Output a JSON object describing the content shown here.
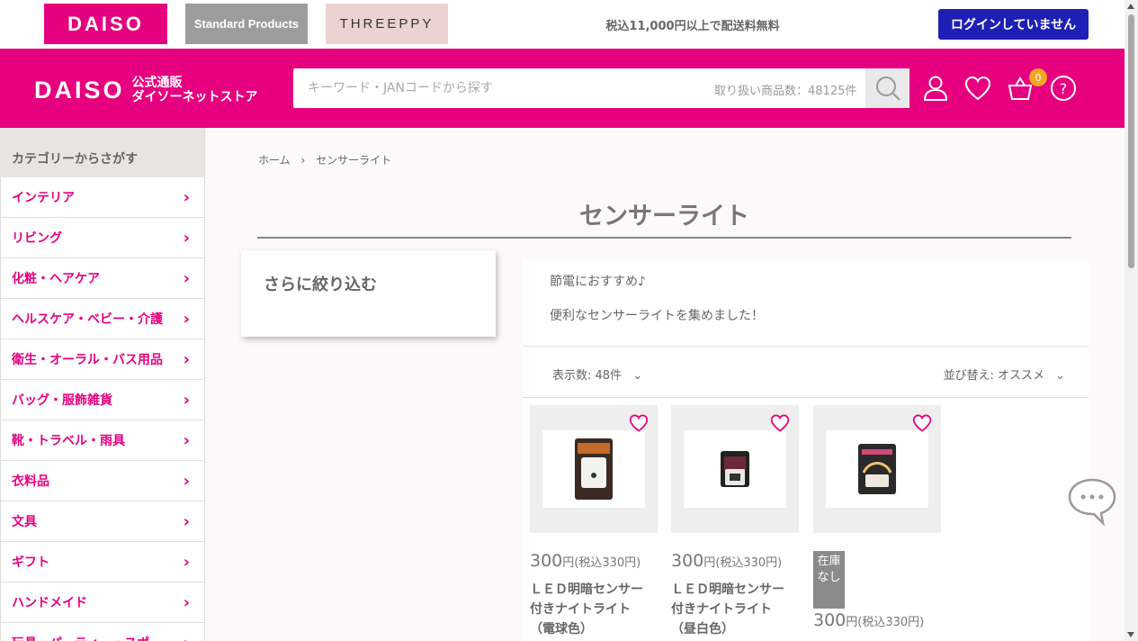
{
  "topbar": {
    "tabs": [
      "DAISO",
      "Standard Products",
      "THREEPPY"
    ],
    "free_shipping": "税込11,000円以上で配送料無料",
    "login_label": "ログインしていません"
  },
  "header": {
    "logo_main": "DAISO",
    "logo_sub_line1": "公式通販",
    "logo_sub_line2": "ダイソーネットストア",
    "search_placeholder": "キーワード・JANコードから探す",
    "search_count": "取り扱い商品数：48125件",
    "cart_count": "0",
    "brand_color": "#e6007f"
  },
  "sidebar": {
    "heading": "カテゴリーからさがす",
    "items": [
      {
        "label": "インテリア"
      },
      {
        "label": "リビング"
      },
      {
        "label": "化粧・ヘアケア"
      },
      {
        "label": "ヘルスケア・ベビー・介護"
      },
      {
        "label": "衛生・オーラル・バス用品"
      },
      {
        "label": "バッグ・服飾雑貨"
      },
      {
        "label": "靴・トラベル・雨具"
      },
      {
        "label": "衣料品"
      },
      {
        "label": "文具"
      },
      {
        "label": "ギフト"
      },
      {
        "label": "ハンドメイド"
      },
      {
        "label": "玩具・パーティー・スポ"
      }
    ]
  },
  "main": {
    "breadcrumb": [
      "ホーム",
      "›",
      "センサーライト"
    ],
    "title": "センサーライト",
    "filter_title": "さらに絞り込む",
    "desc_line1": "節電におすすめ♪",
    "desc_line2": "便利なセンサーライトを集めました！",
    "display_count": "表示数: 48件",
    "sort_label": "並び替え: オススメ",
    "products": [
      {
        "price": "300",
        "price_unit": "円",
        "price_tax": "(税込330円)",
        "name_line1": "ＬＥＤ明暗センサー",
        "name_line2": "付きナイトライト",
        "name_line3": "（電球色）"
      },
      {
        "price": "300",
        "price_unit": "円",
        "price_tax": "(税込330円)",
        "name_line1": "ＬＥＤ明暗センサー",
        "name_line2": "付きナイトライト",
        "name_line3": "（昼白色）"
      },
      {
        "price": "300",
        "price_unit": "円",
        "price_tax": "(税込330円)",
        "oos_label": "在庫なし"
      }
    ]
  }
}
